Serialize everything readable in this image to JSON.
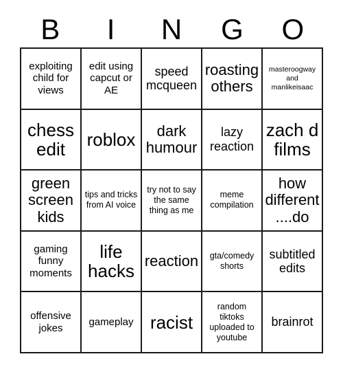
{
  "header": {
    "letters": [
      "B",
      "I",
      "N",
      "G",
      "O"
    ]
  },
  "grid": {
    "rows": 5,
    "columns": 5,
    "border_color": "#1a1a1a",
    "background_color": "#ffffff",
    "text_color": "#000000",
    "cells": [
      {
        "text": "exploiting child for views",
        "size": "fs-m"
      },
      {
        "text": "edit using capcut or AE",
        "size": "fs-m"
      },
      {
        "text": "speed mcqueen",
        "size": "fs-l"
      },
      {
        "text": "roasting others",
        "size": "fs-xl"
      },
      {
        "text": "masteroogway and manlikeisaac",
        "size": "fs-xs"
      },
      {
        "text": "chess edit",
        "size": "fs-xxl"
      },
      {
        "text": "roblox",
        "size": "fs-xxl"
      },
      {
        "text": "dark humour",
        "size": "fs-xl"
      },
      {
        "text": "lazy reaction",
        "size": "fs-l"
      },
      {
        "text": "zach d films",
        "size": "fs-xxl"
      },
      {
        "text": "green screen kids",
        "size": "fs-xl"
      },
      {
        "text": "tips and tricks from AI voice",
        "size": "fs-s"
      },
      {
        "text": "try not to say the same thing as me",
        "size": "fs-s"
      },
      {
        "text": "meme compilation",
        "size": "fs-s"
      },
      {
        "text": "how different ....do",
        "size": "fs-xl"
      },
      {
        "text": "gaming funny moments",
        "size": "fs-m"
      },
      {
        "text": "life hacks",
        "size": "fs-xxl"
      },
      {
        "text": "reaction",
        "size": "fs-xl"
      },
      {
        "text": "gta/comedy shorts",
        "size": "fs-s"
      },
      {
        "text": "subtitled edits",
        "size": "fs-l"
      },
      {
        "text": "offensive jokes",
        "size": "fs-m"
      },
      {
        "text": "gameplay",
        "size": "fs-m"
      },
      {
        "text": "racist",
        "size": "fs-xxl"
      },
      {
        "text": "random tiktoks uploaded to youtube",
        "size": "fs-s"
      },
      {
        "text": "brainrot",
        "size": "fs-l"
      }
    ]
  }
}
